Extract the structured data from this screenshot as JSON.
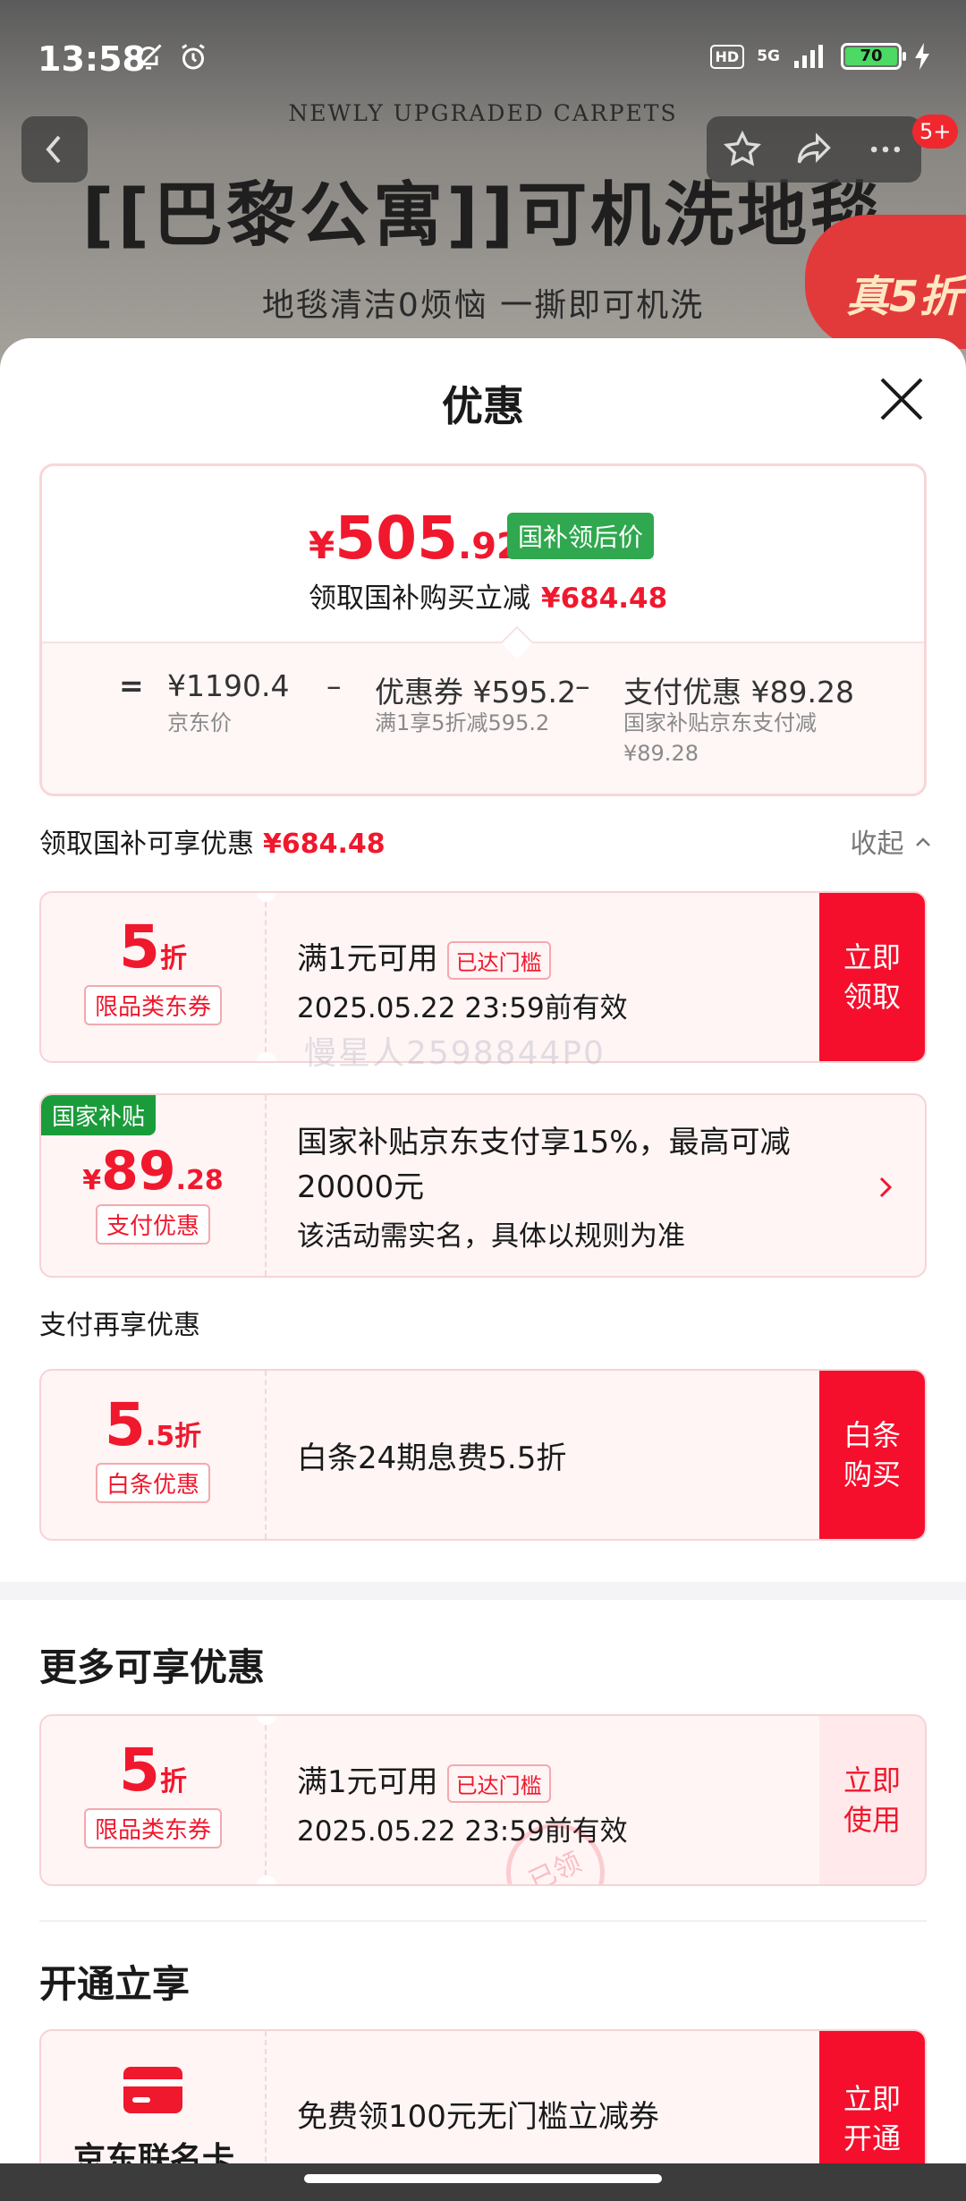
{
  "status_bar": {
    "time": "13:58",
    "network": "5G",
    "hd": "HD",
    "battery": "70"
  },
  "banner": {
    "subtitle": "NEWLY UPGRADED CARPETS",
    "title": "[[巴黎公寓]]可机洗地毯",
    "slogan": "地毯清洁0烦恼 一撕即可机洗",
    "badge": "真5折"
  },
  "nav": {
    "badge_count": "5+"
  },
  "sheet": {
    "title": "优惠",
    "summary": {
      "currency": "¥",
      "price_int": "505",
      "price_dec": ".92",
      "price_tag": "国补领后价",
      "reduce_label": "领取国补购买立减",
      "reduce_value": "¥684.48",
      "equals": "=",
      "minus": "–",
      "jd_price": "¥1190.4",
      "jd_price_label": "京东价",
      "coupon_label": "优惠券",
      "coupon_value": "¥595.2",
      "coupon_sub": "满1享5折减595.2",
      "pay_label": "支付优惠",
      "pay_value": "¥89.28",
      "pay_sub": "国家补贴京东支付减",
      "pay_sub2": "¥89.28"
    },
    "section1": {
      "label": "领取国补可享优惠",
      "value": "¥684.48",
      "collapse": "收起"
    },
    "coupon1": {
      "discount": "5",
      "unit": "折",
      "type": "限品类东券",
      "condition": "满1元可用",
      "reached": "已达门槛",
      "expiry": "2025.05.22 23:59前有效",
      "action": "立即领取"
    },
    "watermark": "慢星人2598844P0",
    "gov": {
      "tag": "国家补贴",
      "cur": "¥",
      "amount": "89",
      "dec": ".28",
      "type": "支付优惠",
      "desc": "国家补贴京东支付享15%，最高可减20000元",
      "note": "该活动需实名，具体以规则为准"
    },
    "pay_again_label": "支付再享优惠",
    "baitiao": {
      "discount": "5",
      "dec": ".5",
      "unit": "折",
      "type": "白条优惠",
      "desc": "白条24期息费5.5折",
      "action": "白条购买"
    },
    "more_title": "更多可享优惠",
    "coupon2": {
      "discount": "5",
      "unit": "折",
      "type": "限品类东券",
      "condition": "满1元可用",
      "reached": "已达门槛",
      "expiry": "2025.05.22 23:59前有效",
      "action": "立即使用",
      "stamp": "已领"
    },
    "open_title": "开通立享",
    "card": {
      "name": "京东联名卡",
      "desc": "免费领100元无门槛立减券",
      "action": "立即开通"
    }
  }
}
